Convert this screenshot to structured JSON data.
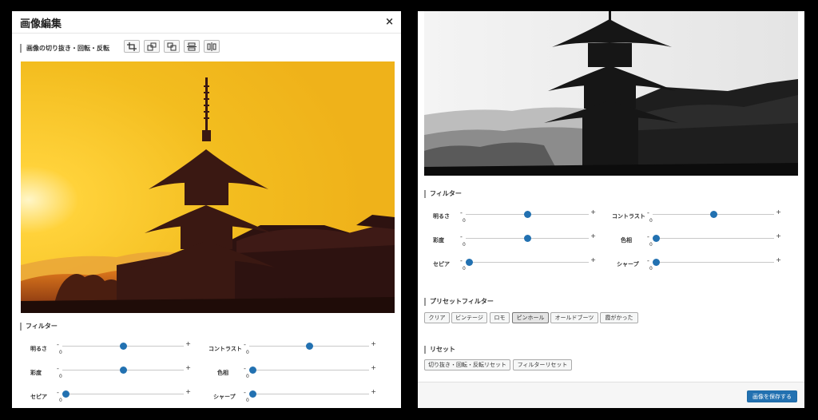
{
  "left": {
    "title": "画像編集",
    "close": "×",
    "toolbar_label": "画像の切り抜き・回転・反転",
    "tools": [
      "crop-icon",
      "rotate-left-icon",
      "rotate-right-icon",
      "flip-vertical-icon",
      "flip-horizontal-icon"
    ],
    "filters_title": "フィルター",
    "filters": [
      {
        "label": "明るさ",
        "value": "0",
        "level": 0.5
      },
      {
        "label": "コントラスト",
        "value": "0",
        "level": 0.5
      },
      {
        "label": "彩度",
        "value": "0",
        "level": 0.5
      },
      {
        "label": "色相",
        "value": "0",
        "level": 0.0
      },
      {
        "label": "セピア",
        "value": "0",
        "level": 0.0
      },
      {
        "label": "シャープ",
        "value": "0",
        "level": 0.0
      }
    ]
  },
  "right": {
    "filters_title": "フィルター",
    "filters": [
      {
        "label": "明るさ",
        "value": "0",
        "level": 0.5
      },
      {
        "label": "コントラスト",
        "value": "0",
        "level": 0.5
      },
      {
        "label": "彩度",
        "value": "0",
        "level": 0.5
      },
      {
        "label": "色相",
        "value": "0",
        "level": 0.0
      },
      {
        "label": "セピア",
        "value": "0",
        "level": 0.0
      },
      {
        "label": "シャープ",
        "value": "0",
        "level": 0.0
      }
    ],
    "preset_title": "プリセットフィルター",
    "presets": [
      "クリア",
      "ビンテージ",
      "ロモ",
      "ピンホール",
      "オールドブーツ",
      "霞がかった"
    ],
    "active_preset": "ピンホール",
    "reset_title": "リセット",
    "reset_buttons": [
      "切り抜き・回転・反転リセット",
      "フィルターリセット"
    ],
    "save_label": "画像を保存する"
  },
  "colors": {
    "accent": "#2271b1",
    "sky_color": "#f0c21c",
    "sunset_orange": "#e8721c"
  }
}
